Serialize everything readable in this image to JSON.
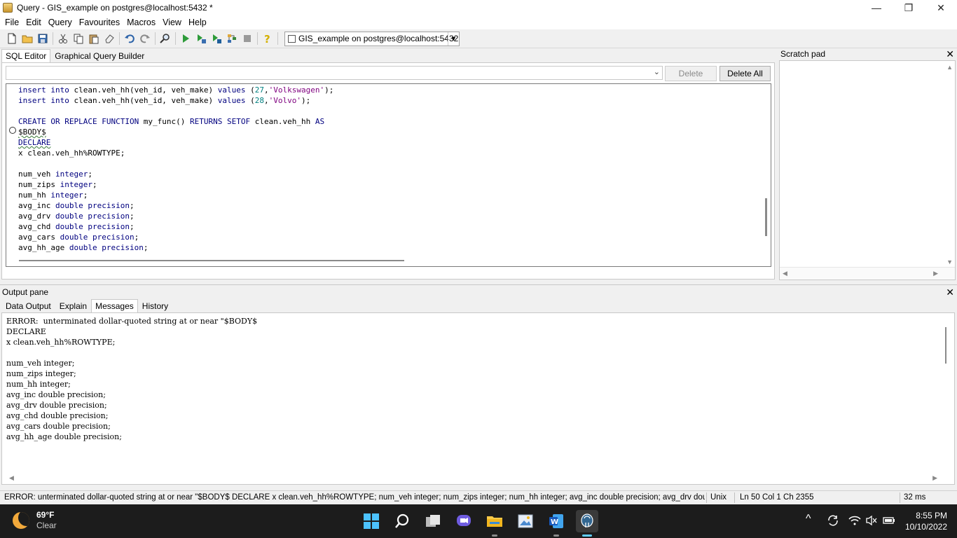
{
  "window": {
    "title": "Query - GIS_example on postgres@localhost:5432 *",
    "controls": {
      "minimize": "—",
      "restore": "❐",
      "close": "✕"
    }
  },
  "menu": [
    "File",
    "Edit",
    "Query",
    "Favourites",
    "Macros",
    "View",
    "Help"
  ],
  "toolbar": {
    "connection": "GIS_example on postgres@localhost:5432",
    "icons": [
      "new-file-icon",
      "open-folder-icon",
      "save-icon",
      "cut-icon",
      "copy-icon",
      "paste-icon",
      "clear-icon",
      "undo-icon",
      "redo-icon",
      "find-icon",
      "execute-icon",
      "execute-pgscript-icon",
      "execute-to-file-icon",
      "explain-icon",
      "cancel-icon",
      "help-icon"
    ]
  },
  "editor": {
    "tabs": [
      "SQL Editor",
      "Graphical Query Builder"
    ],
    "active_tab": "SQL Editor",
    "delete_label": "Delete",
    "delete_all_label": "Delete All"
  },
  "scratch_pad": {
    "title": "Scratch pad",
    "close": "✕"
  },
  "output": {
    "title": "Output pane",
    "close": "✕",
    "tabs": [
      "Data Output",
      "Explain",
      "Messages",
      "History"
    ],
    "active_tab": "Messages",
    "message": "ERROR:  unterminated dollar-quoted string at or near \"$BODY$\nDECLARE\nx clean.veh_hh%ROWTYPE;\n\nnum_veh integer;\nnum_zips integer;\nnum_hh integer;\navg_inc double precision;\navg_drv double precision;\navg_chd double precision;\navg_cars double precision;\navg_hh_age double precision;"
  },
  "status": {
    "message": "ERROR: unterminated dollar-quoted string at or near \"$BODY$ DECLARE x clean.veh_hh%ROWTYPE;  num_veh integer; num_zips integer; num_hh integer; avg_inc double precision; avg_drv double precision;",
    "line_ending": "Unix",
    "position": "Ln 50 Col 1 Ch 2355",
    "time": "32 ms"
  },
  "taskbar": {
    "temperature": "69°F",
    "condition": "Clear",
    "time": "8:55 PM",
    "date": "10/10/2022",
    "apps": [
      "start-icon",
      "search-icon",
      "task-view-icon",
      "chat-icon",
      "file-explorer-icon",
      "photos-icon",
      "word-icon",
      "pgadmin-icon"
    ],
    "tray_chevron": "^"
  },
  "colors": {
    "keyword": "#00007f",
    "string": "#7f007f",
    "number": "#007f7f",
    "taskbar": "#1c1c1c",
    "accent": "#60cdff"
  }
}
